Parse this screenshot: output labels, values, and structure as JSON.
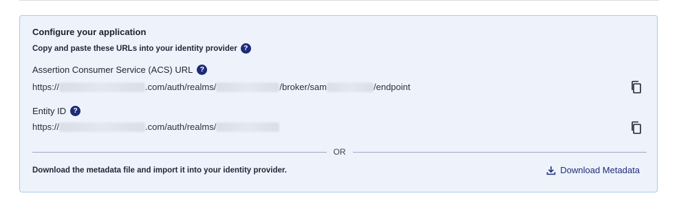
{
  "section": {
    "title": "Configure your application",
    "subtitle": "Copy and paste these URLs into your identity provider",
    "help_icon": "question-circle-icon"
  },
  "acs": {
    "label": "Assertion Consumer Service (ACS) URL",
    "url_parts": [
      "https://",
      ".com/auth/realms/",
      "/broker/sam",
      "/endpoint"
    ],
    "copy_icon": "copy-icon"
  },
  "entity": {
    "label": "Entity ID",
    "url_parts": [
      "https://",
      ".com/auth/realms/"
    ],
    "copy_icon": "copy-icon"
  },
  "divider": {
    "text": "OR"
  },
  "download": {
    "description": "Download the metadata file and import it into your identity provider.",
    "link_label": "Download Metadata",
    "icon": "download-icon"
  },
  "colors": {
    "panel_bg": "#eef3fb",
    "panel_border": "#a9c7ee",
    "accent": "#1e2a78"
  }
}
